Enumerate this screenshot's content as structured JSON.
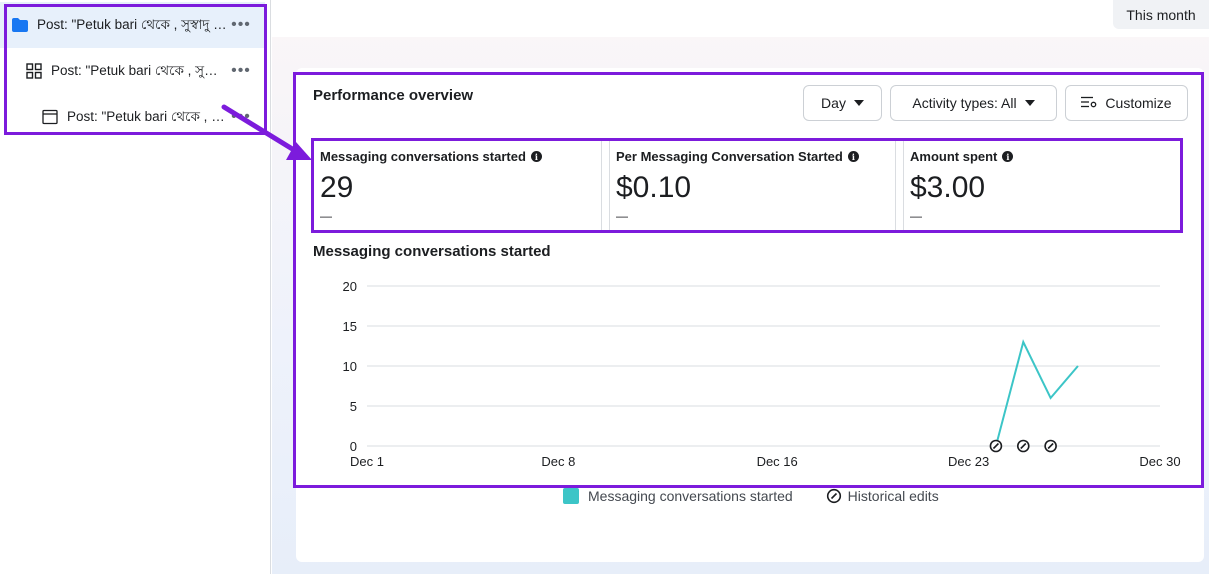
{
  "tree": {
    "items": [
      {
        "label": "Post: \"Petuk bari থেকে , সুস্বাদু খাবার\"",
        "icon": "folder-icon",
        "selected": true
      },
      {
        "label": "Post: \"Petuk bari থেকে , সুস্বাদু খাবার\"",
        "icon": "grid-icon",
        "selected": false
      },
      {
        "label": "Post: \"Petuk bari থেকে , সুস্বাদু খাবার\"",
        "icon": "ad-icon",
        "selected": false
      }
    ],
    "more_label": "•••"
  },
  "header": {
    "date_range": "This month"
  },
  "performance": {
    "title": "Performance overview",
    "buttons": {
      "day": "Day",
      "activity": "Activity types: All",
      "customize": "Customize"
    }
  },
  "metrics": [
    {
      "title": "Messaging conversations started",
      "value": "29",
      "delta": "—"
    },
    {
      "title": "Per Messaging Conversation Started",
      "value": "$0.10",
      "delta": "—"
    },
    {
      "title": "Amount spent",
      "value": "$3.00",
      "delta": "—"
    }
  ],
  "chart_data": {
    "type": "line",
    "title": "Messaging conversations started",
    "x_labels": [
      "Dec 1",
      "Dec 8",
      "Dec 16",
      "Dec 23",
      "Dec 30"
    ],
    "x_label_days": [
      1,
      8,
      16,
      23,
      30
    ],
    "ylim": [
      0,
      20
    ],
    "yticks": [
      0,
      5,
      10,
      15,
      20
    ],
    "grid": true,
    "series": [
      {
        "name": "Messaging conversations started",
        "color": "#3cc5c7",
        "x": [
          24,
          25,
          26,
          27
        ],
        "values": [
          0,
          13,
          6,
          10
        ]
      }
    ],
    "historical_edits_days": [
      24,
      25,
      26
    ],
    "legend": [
      "Messaging conversations started",
      "Historical edits"
    ],
    "legend_position": "bottom"
  },
  "colors": {
    "accent": "#7c1bdc",
    "series": "#3cc5c7",
    "selected_row": "#e7f0fb",
    "folder": "#1877f2"
  }
}
